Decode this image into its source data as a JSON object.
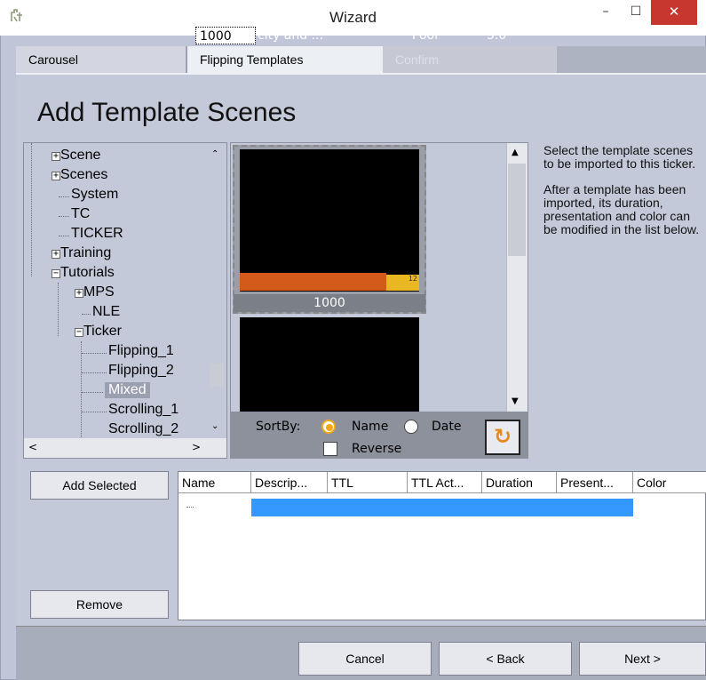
{
  "window": {
    "title": "Wizard",
    "icon": "wizard-icon"
  },
  "tabs": [
    {
      "label": "Carousel",
      "state": "inactive"
    },
    {
      "label": "Flipping Templates",
      "state": "active"
    },
    {
      "label": "Confirm",
      "state": "disabled"
    }
  ],
  "page": {
    "title": "Add Template Scenes"
  },
  "tree": {
    "items": [
      {
        "label": "Scene",
        "expander": "+"
      },
      {
        "label": "Scenes",
        "expander": "+"
      },
      {
        "label": "System",
        "expander": ""
      },
      {
        "label": "TC",
        "expander": ""
      },
      {
        "label": "TICKER",
        "expander": ""
      },
      {
        "label": "Training",
        "expander": "+"
      },
      {
        "label": "Tutorials",
        "expander": "−"
      },
      {
        "label": "MPS",
        "expander": "+"
      },
      {
        "label": "NLE",
        "expander": ""
      },
      {
        "label": "Ticker",
        "expander": "−"
      },
      {
        "label": "Flipping_1",
        "expander": ""
      },
      {
        "label": "Flipping_2",
        "expander": ""
      },
      {
        "label": "Mixed",
        "expander": "",
        "selected": true
      },
      {
        "label": "Scrolling_1",
        "expander": ""
      },
      {
        "label": "Scrolling_2",
        "expander": ""
      }
    ]
  },
  "preview": {
    "thumbnails": [
      {
        "label": "1000",
        "badge": "12"
      },
      {
        "label": ""
      }
    ]
  },
  "sort": {
    "label": "SortBy:",
    "options": [
      "Name",
      "Date"
    ],
    "selected": "Name",
    "reverse_label": "Reverse",
    "reverse_checked": false
  },
  "help": {
    "para1": "Select the template scenes to be imported to this ticker.",
    "para2": "After a template has been imported, its duration, presentation and color can be modified in the list below."
  },
  "buttons": {
    "add_selected": "Add Selected",
    "remove": "Remove",
    "cancel": "Cancel",
    "back": "< Back",
    "next": "Next >"
  },
  "grid": {
    "columns": [
      "Name",
      "Descrip...",
      "TTL",
      "TTL Act...",
      "Duration",
      "Present...",
      "Color"
    ],
    "rows": [
      {
        "name": "1000",
        "description": "city and ...",
        "ttl": "",
        "ttl_action": "Pool",
        "duration": "5.0",
        "presentation": "",
        "color": ""
      }
    ]
  },
  "colors": {
    "accent": "#3399ff",
    "radio": "#f3a81b",
    "close": "#c7372f"
  }
}
